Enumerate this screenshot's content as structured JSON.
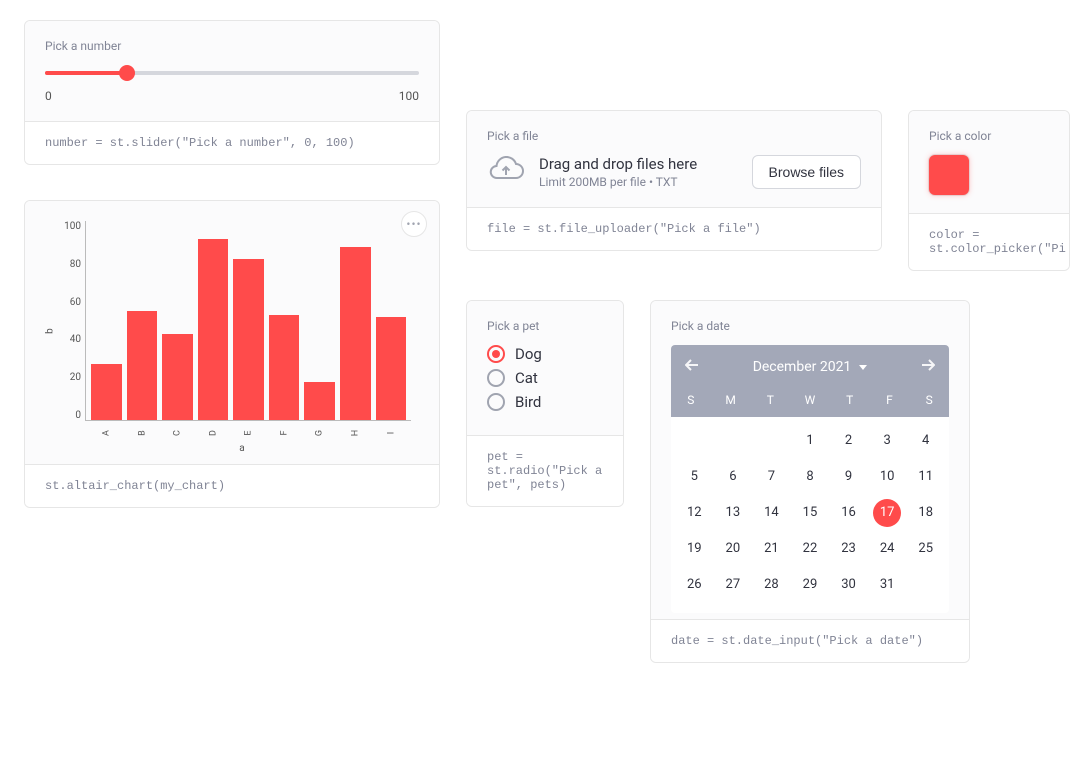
{
  "slider": {
    "label": "Pick a number",
    "min": "0",
    "max": "100",
    "value_pct": 22,
    "code": "number = st.slider(\"Pick a number\", 0, 100)"
  },
  "chart_data": {
    "type": "bar",
    "categories": [
      "A",
      "B",
      "C",
      "D",
      "E",
      "F",
      "G",
      "H",
      "I"
    ],
    "values": [
      28,
      55,
      43,
      91,
      81,
      53,
      19,
      87,
      52
    ],
    "title": "",
    "xlabel": "a",
    "ylabel": "b",
    "ylim": [
      0,
      100
    ],
    "yticks": [
      "100",
      "80",
      "60",
      "40",
      "20",
      "0"
    ]
  },
  "chart_code": "st.altair_chart(my_chart)",
  "chart_menu_icon": "ellipsis-icon",
  "file": {
    "label": "Pick a file",
    "drop_text": "Drag and drop files here",
    "limit_text": "Limit 200MB per file • TXT",
    "browse_label": "Browse files",
    "code": "file = st.file_uploader(\"Pick a file\")"
  },
  "color": {
    "label": "Pick a color",
    "value": "#ff4b4b",
    "code": "color = st.color_picker(\"Pi"
  },
  "pet": {
    "label": "Pick a pet",
    "options": [
      {
        "label": "Dog",
        "selected": true
      },
      {
        "label": "Cat",
        "selected": false
      },
      {
        "label": "Bird",
        "selected": false
      }
    ],
    "code": "pet = \nst.radio(\"Pick a pet\", pets)"
  },
  "date": {
    "label": "Pick a date",
    "month_label": "December 2021",
    "dow": [
      "S",
      "M",
      "T",
      "W",
      "T",
      "F",
      "S"
    ],
    "leading_blanks": 3,
    "days": 31,
    "selected_day": 17,
    "code": "date = st.date_input(\"Pick a date\")"
  }
}
